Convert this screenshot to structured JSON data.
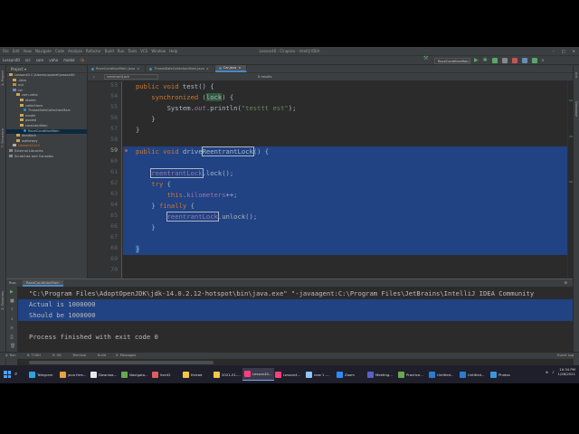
{
  "window": {
    "title": "Lesson40 - Cinqeico - IntelliJ IDEA",
    "menu": [
      "File",
      "Edit",
      "View",
      "Navigate",
      "Code",
      "Analyze",
      "Refactor",
      "Build",
      "Run",
      "Tools",
      "VCS",
      "Window",
      "Help"
    ],
    "controls": [
      "–",
      "□",
      "✕"
    ]
  },
  "navbar": {
    "breadcrumbs": [
      "Lesson40",
      "src",
      "com",
      "vaha",
      "model",
      "lib"
    ],
    "run_config": "RaceConditionMain",
    "run_icon": "play-icon"
  },
  "project": {
    "header": "Project ▾",
    "tree": [
      {
        "label": "Lesson40  C:\\Users\\nspanel\\Lesson40",
        "type": "folder",
        "indent": 0
      },
      {
        "label": ".idea",
        "type": "folder",
        "indent": 1
      },
      {
        "label": "out",
        "type": "folder-orange",
        "indent": 1
      },
      {
        "label": "src",
        "type": "folder-blue",
        "indent": 1
      },
      {
        "label": "com.vaha",
        "type": "folder",
        "indent": 2
      },
      {
        "label": "atomic",
        "type": "folder",
        "indent": 3
      },
      {
        "label": "collections",
        "type": "folder",
        "indent": 3
      },
      {
        "label": "ThreadSafeCollectionMain",
        "type": "class",
        "indent": 4
      },
      {
        "label": "model",
        "type": "folder",
        "indent": 3
      },
      {
        "label": "pooled",
        "type": "folder",
        "indent": 3
      },
      {
        "label": "racecondition",
        "type": "folder",
        "indent": 3
      },
      {
        "label": "RaceConditionMain",
        "type": "class",
        "indent": 4,
        "selected": true
      },
      {
        "label": "deadlock",
        "type": "folder",
        "indent": 2
      },
      {
        "label": "walkaway",
        "type": "folder",
        "indent": 2
      },
      {
        "label": "Lesson40.iml",
        "type": "file",
        "indent": 1
      },
      {
        "label": "External Libraries",
        "type": "lib",
        "indent": 0
      },
      {
        "label": "Scratches and Consoles",
        "type": "lib",
        "indent": 0
      }
    ]
  },
  "tabs": [
    {
      "label": "RaceConditionMain.java",
      "active": false
    },
    {
      "label": "ThreadSafeCollectionMain.java",
      "active": false
    },
    {
      "label": "Car.java",
      "active": true
    }
  ],
  "search": {
    "query": "reentrantLock",
    "results": "0 results"
  },
  "editor": {
    "line_numbers": [
      "53",
      "54",
      "55",
      "56",
      "57",
      "58",
      "59",
      "60",
      "61",
      "62",
      "63",
      "64",
      "65",
      "66",
      "67",
      "68",
      "69",
      "70"
    ],
    "line_at_59": "59"
  },
  "run": {
    "header": "Run:",
    "tab": "RaceConditionMain",
    "command": "\"C:\\Program Files\\AdoptOpenJDK\\jdk-14.0.2.12-hotspot\\bin\\java.exe\" \"-javaagent:C:\\Program Files\\JetBrains\\IntelliJ IDEA Community",
    "line1": "Actual is 1000000",
    "line2": "Should be 1000000",
    "line3": "Process finished with exit code 0"
  },
  "bottom_tools": [
    "4: Run",
    "6: TODO",
    "9: Git",
    "Terminal",
    "Build",
    "0: Messages",
    "Event Log"
  ],
  "status": {
    "message": "Build completed successfully in 1 s 352 ms (2 minutes ago)",
    "right": [
      "59:1",
      "CRLF",
      "UTF-8",
      "4 spaces",
      "Git: master"
    ]
  },
  "taskbar": {
    "items": [
      "Telegram",
      "java thre...",
      "Downloa...",
      "Navigato...",
      "live42",
      "thread",
      "2021-01-...",
      "Lesson40...",
      "Lesson4...",
      "new 1 -...",
      "Zoom",
      "Meeting...",
      "Practice...",
      "Untitled...",
      "Untitled...",
      "Photos"
    ],
    "active_index": 7,
    "time": "10:34 PM",
    "date": "1/26/2021"
  }
}
